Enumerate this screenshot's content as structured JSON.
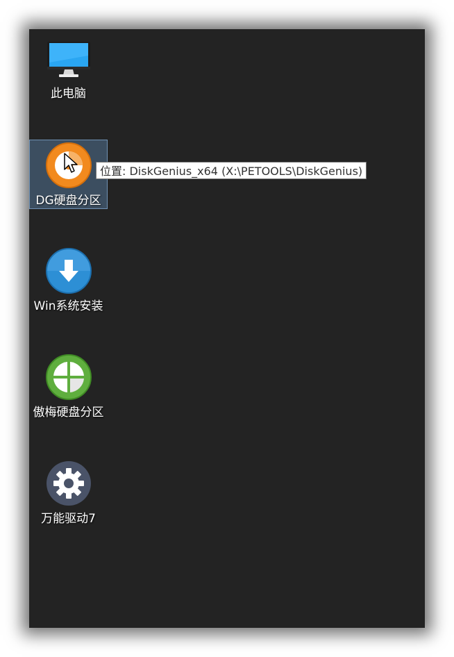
{
  "desktop": {
    "background_color": "#232323",
    "icons": [
      {
        "label": "此电脑",
        "icon": "computer-monitor-icon",
        "selected": false
      },
      {
        "label": "DG硬盘分区",
        "icon": "diskgenius-icon",
        "selected": true,
        "accent": "#f28a1e"
      },
      {
        "label": "Win系统安装",
        "icon": "download-arrow-icon",
        "selected": false,
        "accent": "#2d8fd5"
      },
      {
        "label": "傲梅硬盘分区",
        "icon": "aomei-partition-icon",
        "selected": false,
        "accent": "#5fae3e"
      },
      {
        "label": "万能驱动7",
        "icon": "gear-icon",
        "selected": false,
        "accent": "#4a5368"
      }
    ]
  },
  "tooltip": {
    "text": "位置: DiskGenius_x64 (X:\\PETOOLS\\DiskGenius)"
  }
}
